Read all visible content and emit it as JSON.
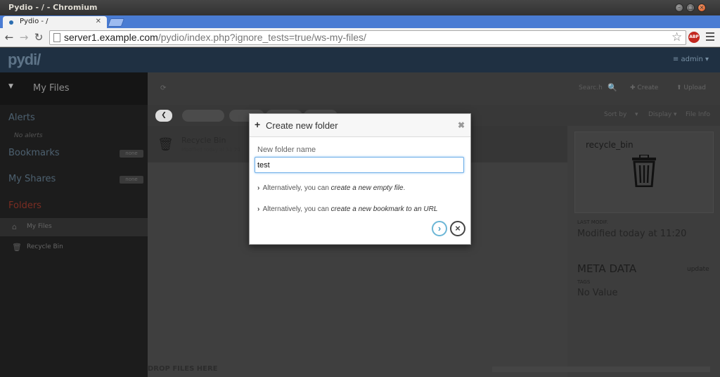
{
  "window": {
    "title": "Pydio - / - Chromium"
  },
  "browser": {
    "tab_title": "Pydio - /",
    "url_host": "server1.example.com",
    "url_path": "/pydio/index.php?ignore_tests=true/ws-my-files/"
  },
  "app": {
    "logo": "pydi/",
    "user": "≡ admin ▾"
  },
  "sidebar": {
    "workspace": "My Files",
    "alerts": {
      "title": "Alerts",
      "sub": "No alerts"
    },
    "bookmarks": {
      "title": "Bookmarks",
      "btn": "none"
    },
    "shares": {
      "title": "My Shares",
      "btn": "none"
    },
    "folders_title": "Folders",
    "tree": [
      {
        "label": "My Files",
        "icon": "home-icon"
      },
      {
        "label": "Recycle Bin",
        "icon": "trash-icon"
      }
    ]
  },
  "toolbar": {
    "search_placeholder": "Searc.h",
    "create": "Create",
    "upload": "Upload"
  },
  "listing": {
    "rows": [
      {
        "title": "Recycle Bin",
        "subtitle": "Modified today at 11:20"
      }
    ],
    "drop_hint": "DROP FILES HERE"
  },
  "sort": {
    "sort_by": "Sort by",
    "display": "Display ▾",
    "file_info": "File Info"
  },
  "info_panel": {
    "card_title": "recycle_bin",
    "last_modif_label": "LAST MODIF.",
    "last_modif_value": "Modified today at 11:20",
    "meta_title": "META DATA",
    "meta_update": "update",
    "tags_label": "TAGS",
    "tags_value": "No Value"
  },
  "modal": {
    "title": "Create new folder",
    "field_label": "New folder name",
    "field_value": "test",
    "alt_prefix": "Alternatively, you can",
    "alt_file_link": "create a new empty file",
    "alt_bookmark_link": "create a new bookmark to an URL"
  }
}
